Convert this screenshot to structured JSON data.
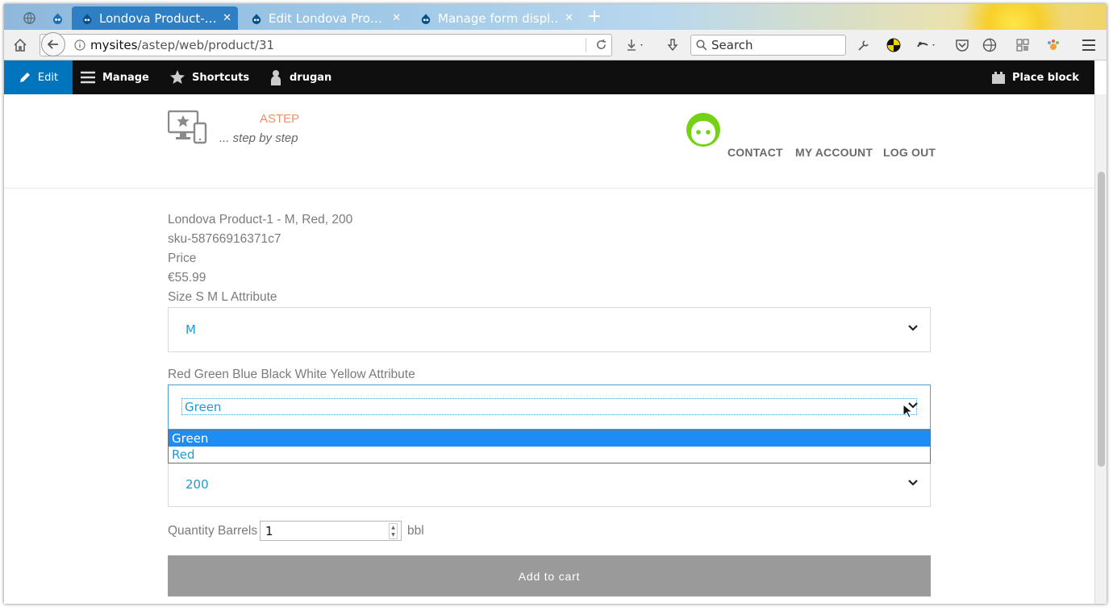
{
  "browser": {
    "tabs": [
      {
        "title": "Londova Product-…",
        "active": true
      },
      {
        "title": "Edit Londova Pro…",
        "active": false
      },
      {
        "title": "Manage form displ…",
        "active": false
      }
    ],
    "url_host": "mysites",
    "url_path": "/astep/web/product/31",
    "search_placeholder": "Search"
  },
  "toolbar": {
    "edit": "Edit",
    "manage": "Manage",
    "shortcuts": "Shortcuts",
    "user": "drugan",
    "place_block": "Place block"
  },
  "site": {
    "name": "ASTEP",
    "slogan": "... step by step",
    "menu": [
      "CONTACT",
      "MY ACCOUNT",
      "LOG OUT"
    ]
  },
  "product": {
    "title": "Londova Product-1 - M, Red, 200",
    "sku": "sku-58766916371c7",
    "price_label": "Price",
    "price": "€55.99",
    "size_label": "Size S M L Attribute",
    "size_value": "M",
    "color_label": "Red Green Blue Black White Yellow Attribute",
    "color_value": "Green",
    "color_options": [
      "Green",
      "Red"
    ],
    "third_value": "200",
    "qty_label": "Quantity Barrels",
    "qty_value": "1",
    "qty_unit": "bbl",
    "add_to_cart": "Add to cart"
  },
  "colors": {
    "toolbar_bg": "#0f0f0f",
    "edit_blue": "#0074bd",
    "link_blue": "#2497d6",
    "selected_option": "#1e8cf5",
    "site_name": "#e8906a",
    "avatar_green": "#74d114",
    "button_gray": "#9a9a9a"
  }
}
